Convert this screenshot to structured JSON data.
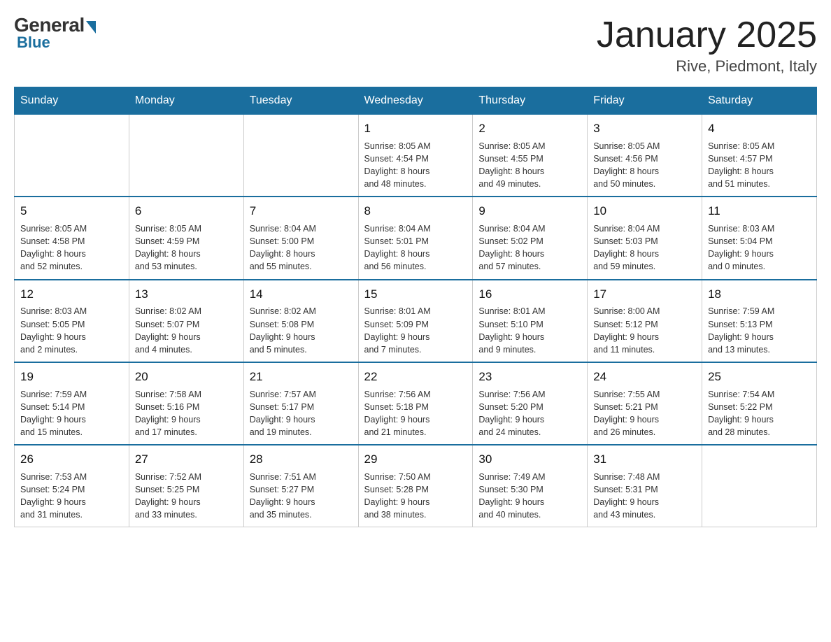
{
  "header": {
    "logo": {
      "general": "General",
      "blue": "Blue"
    },
    "title": "January 2025",
    "location": "Rive, Piedmont, Italy"
  },
  "columns": [
    "Sunday",
    "Monday",
    "Tuesday",
    "Wednesday",
    "Thursday",
    "Friday",
    "Saturday"
  ],
  "weeks": [
    [
      {
        "day": "",
        "info": ""
      },
      {
        "day": "",
        "info": ""
      },
      {
        "day": "",
        "info": ""
      },
      {
        "day": "1",
        "info": "Sunrise: 8:05 AM\nSunset: 4:54 PM\nDaylight: 8 hours\nand 48 minutes."
      },
      {
        "day": "2",
        "info": "Sunrise: 8:05 AM\nSunset: 4:55 PM\nDaylight: 8 hours\nand 49 minutes."
      },
      {
        "day": "3",
        "info": "Sunrise: 8:05 AM\nSunset: 4:56 PM\nDaylight: 8 hours\nand 50 minutes."
      },
      {
        "day": "4",
        "info": "Sunrise: 8:05 AM\nSunset: 4:57 PM\nDaylight: 8 hours\nand 51 minutes."
      }
    ],
    [
      {
        "day": "5",
        "info": "Sunrise: 8:05 AM\nSunset: 4:58 PM\nDaylight: 8 hours\nand 52 minutes."
      },
      {
        "day": "6",
        "info": "Sunrise: 8:05 AM\nSunset: 4:59 PM\nDaylight: 8 hours\nand 53 minutes."
      },
      {
        "day": "7",
        "info": "Sunrise: 8:04 AM\nSunset: 5:00 PM\nDaylight: 8 hours\nand 55 minutes."
      },
      {
        "day": "8",
        "info": "Sunrise: 8:04 AM\nSunset: 5:01 PM\nDaylight: 8 hours\nand 56 minutes."
      },
      {
        "day": "9",
        "info": "Sunrise: 8:04 AM\nSunset: 5:02 PM\nDaylight: 8 hours\nand 57 minutes."
      },
      {
        "day": "10",
        "info": "Sunrise: 8:04 AM\nSunset: 5:03 PM\nDaylight: 8 hours\nand 59 minutes."
      },
      {
        "day": "11",
        "info": "Sunrise: 8:03 AM\nSunset: 5:04 PM\nDaylight: 9 hours\nand 0 minutes."
      }
    ],
    [
      {
        "day": "12",
        "info": "Sunrise: 8:03 AM\nSunset: 5:05 PM\nDaylight: 9 hours\nand 2 minutes."
      },
      {
        "day": "13",
        "info": "Sunrise: 8:02 AM\nSunset: 5:07 PM\nDaylight: 9 hours\nand 4 minutes."
      },
      {
        "day": "14",
        "info": "Sunrise: 8:02 AM\nSunset: 5:08 PM\nDaylight: 9 hours\nand 5 minutes."
      },
      {
        "day": "15",
        "info": "Sunrise: 8:01 AM\nSunset: 5:09 PM\nDaylight: 9 hours\nand 7 minutes."
      },
      {
        "day": "16",
        "info": "Sunrise: 8:01 AM\nSunset: 5:10 PM\nDaylight: 9 hours\nand 9 minutes."
      },
      {
        "day": "17",
        "info": "Sunrise: 8:00 AM\nSunset: 5:12 PM\nDaylight: 9 hours\nand 11 minutes."
      },
      {
        "day": "18",
        "info": "Sunrise: 7:59 AM\nSunset: 5:13 PM\nDaylight: 9 hours\nand 13 minutes."
      }
    ],
    [
      {
        "day": "19",
        "info": "Sunrise: 7:59 AM\nSunset: 5:14 PM\nDaylight: 9 hours\nand 15 minutes."
      },
      {
        "day": "20",
        "info": "Sunrise: 7:58 AM\nSunset: 5:16 PM\nDaylight: 9 hours\nand 17 minutes."
      },
      {
        "day": "21",
        "info": "Sunrise: 7:57 AM\nSunset: 5:17 PM\nDaylight: 9 hours\nand 19 minutes."
      },
      {
        "day": "22",
        "info": "Sunrise: 7:56 AM\nSunset: 5:18 PM\nDaylight: 9 hours\nand 21 minutes."
      },
      {
        "day": "23",
        "info": "Sunrise: 7:56 AM\nSunset: 5:20 PM\nDaylight: 9 hours\nand 24 minutes."
      },
      {
        "day": "24",
        "info": "Sunrise: 7:55 AM\nSunset: 5:21 PM\nDaylight: 9 hours\nand 26 minutes."
      },
      {
        "day": "25",
        "info": "Sunrise: 7:54 AM\nSunset: 5:22 PM\nDaylight: 9 hours\nand 28 minutes."
      }
    ],
    [
      {
        "day": "26",
        "info": "Sunrise: 7:53 AM\nSunset: 5:24 PM\nDaylight: 9 hours\nand 31 minutes."
      },
      {
        "day": "27",
        "info": "Sunrise: 7:52 AM\nSunset: 5:25 PM\nDaylight: 9 hours\nand 33 minutes."
      },
      {
        "day": "28",
        "info": "Sunrise: 7:51 AM\nSunset: 5:27 PM\nDaylight: 9 hours\nand 35 minutes."
      },
      {
        "day": "29",
        "info": "Sunrise: 7:50 AM\nSunset: 5:28 PM\nDaylight: 9 hours\nand 38 minutes."
      },
      {
        "day": "30",
        "info": "Sunrise: 7:49 AM\nSunset: 5:30 PM\nDaylight: 9 hours\nand 40 minutes."
      },
      {
        "day": "31",
        "info": "Sunrise: 7:48 AM\nSunset: 5:31 PM\nDaylight: 9 hours\nand 43 minutes."
      },
      {
        "day": "",
        "info": ""
      }
    ]
  ]
}
